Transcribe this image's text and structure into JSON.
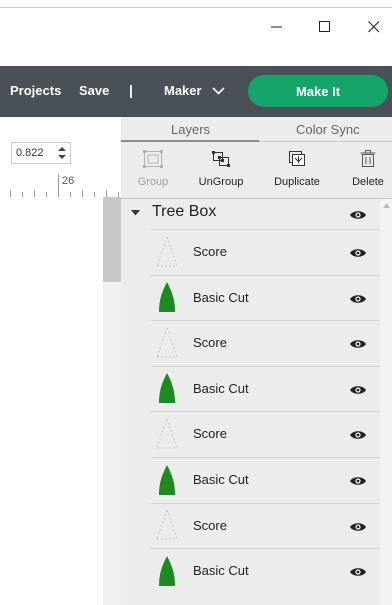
{
  "window": {
    "controls": [
      "minimize-icon",
      "maximize-icon",
      "close-icon"
    ]
  },
  "toolbar": {
    "projects_label": "Projects",
    "save_label": "Save",
    "separator": "|",
    "machine_label": "Maker",
    "make_it_label": "Make It",
    "accent_color": "#13a56a",
    "bar_color": "#4a5058"
  },
  "canvas": {
    "size_value": "0.822",
    "ruler_number": "26"
  },
  "panel": {
    "tabs": [
      {
        "label": "Layers",
        "active": true
      },
      {
        "label": "Color Sync",
        "active": false
      }
    ],
    "tools": [
      {
        "label": "Group",
        "icon": "group-icon",
        "enabled": false
      },
      {
        "label": "UnGroup",
        "icon": "ungroup-icon",
        "enabled": true
      },
      {
        "label": "Duplicate",
        "icon": "duplicate-icon",
        "enabled": true
      },
      {
        "label": "Delete",
        "icon": "trash-icon",
        "enabled": true
      }
    ],
    "group": {
      "name": "Tree Box",
      "layers": [
        {
          "name": "Score",
          "kind": "score",
          "visible": true
        },
        {
          "name": "Basic Cut",
          "kind": "cut",
          "visible": true
        },
        {
          "name": "Score",
          "kind": "score",
          "visible": true
        },
        {
          "name": "Basic Cut",
          "kind": "cut",
          "visible": true
        },
        {
          "name": "Score",
          "kind": "score",
          "visible": true
        },
        {
          "name": "Basic Cut",
          "kind": "cut",
          "visible": true
        },
        {
          "name": "Score",
          "kind": "score",
          "visible": true
        },
        {
          "name": "Basic Cut",
          "kind": "cut",
          "visible": true
        }
      ]
    },
    "cut_color": "#1f8a1f"
  }
}
